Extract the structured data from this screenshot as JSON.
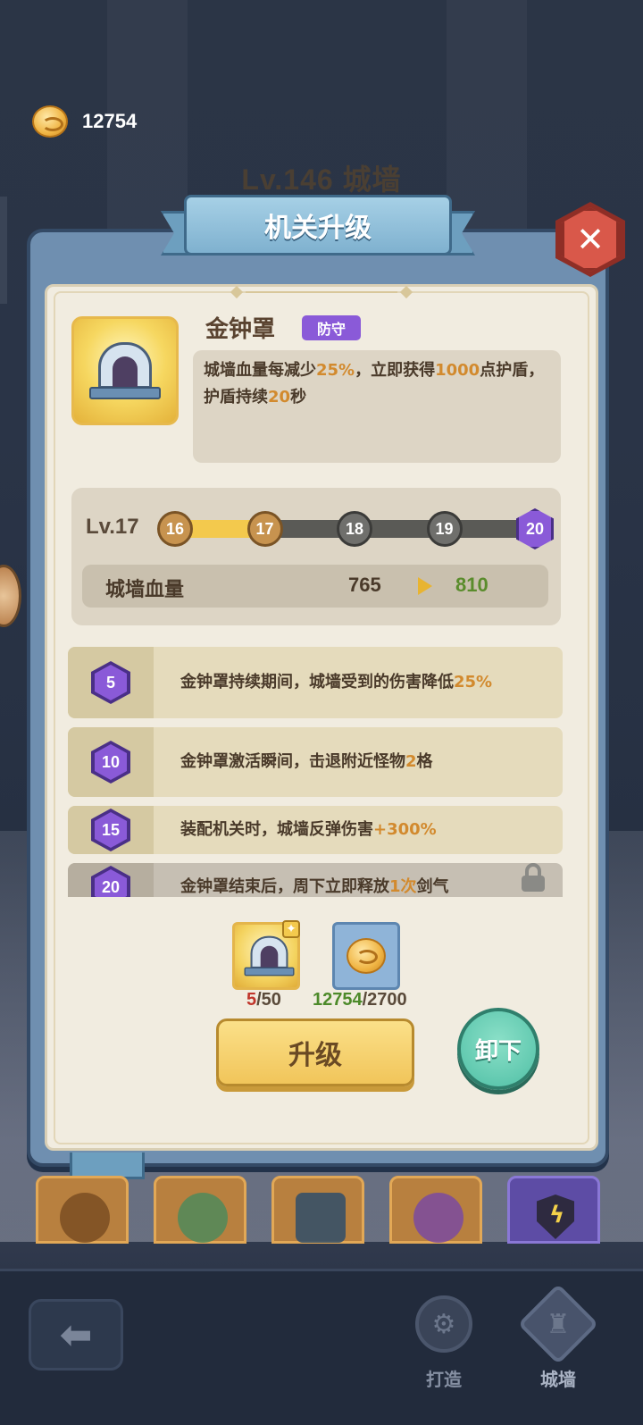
{
  "currency": {
    "icon": "coin-icon",
    "value": "12754"
  },
  "wall_title": "Lv.146 城墙",
  "dialog": {
    "title": "机关升级",
    "close_icon": "close-icon"
  },
  "item": {
    "name": "金钟罩",
    "tag": "防守",
    "icon": "golden-gate-icon",
    "description": {
      "part1": "城墙血量每减少",
      "v1": "25%",
      "part2": "，立即获得",
      "v2": "1000",
      "part3": "点护盾，护盾持续",
      "v3": "20",
      "part4": "秒"
    }
  },
  "level": {
    "label": "Lv.17",
    "current": 17,
    "nodes": [
      "16",
      "17",
      "18",
      "19",
      "20"
    ],
    "stat_label": "城墙血量",
    "stat_current": "765",
    "stat_next": "810"
  },
  "perks": [
    {
      "level": "5",
      "text_a": "金钟罩持续期间，城墙受到的伤害降低",
      "value": "25%",
      "text_b": "",
      "locked": false
    },
    {
      "level": "10",
      "text_a": "金钟罩激活瞬间，击退附近怪物",
      "value": "2",
      "text_b": "格",
      "locked": false
    },
    {
      "level": "15",
      "text_a": "装配机关时，城墙反弹伤害",
      "value": "+300%",
      "text_b": "",
      "locked": false
    },
    {
      "level": "20",
      "text_a": "金钟罩结束后，周下立即释放",
      "value": "1次",
      "text_b": "剑气",
      "locked": true
    }
  ],
  "costs": [
    {
      "icon": "golden-gate-icon",
      "have": "5",
      "need": "/50",
      "insufficient": true
    },
    {
      "icon": "coin-icon",
      "have": "12754",
      "need": "/2700",
      "insufficient": false
    }
  ],
  "buttons": {
    "upgrade": "升级",
    "unload": "卸下"
  },
  "slots": [
    "crossbow-icon",
    "leaf-shield-icon",
    "cannon-icon",
    "crystal-icon",
    "lightning-shield-icon"
  ],
  "bottom_nav": {
    "back_icon": "back-arrow-icon",
    "forge": "打造",
    "wall": "城墙"
  },
  "colors": {
    "highlight": "#d28a2e",
    "green": "#5a8c2c",
    "purple": "#8a5ad8",
    "red": "#c0352b"
  }
}
